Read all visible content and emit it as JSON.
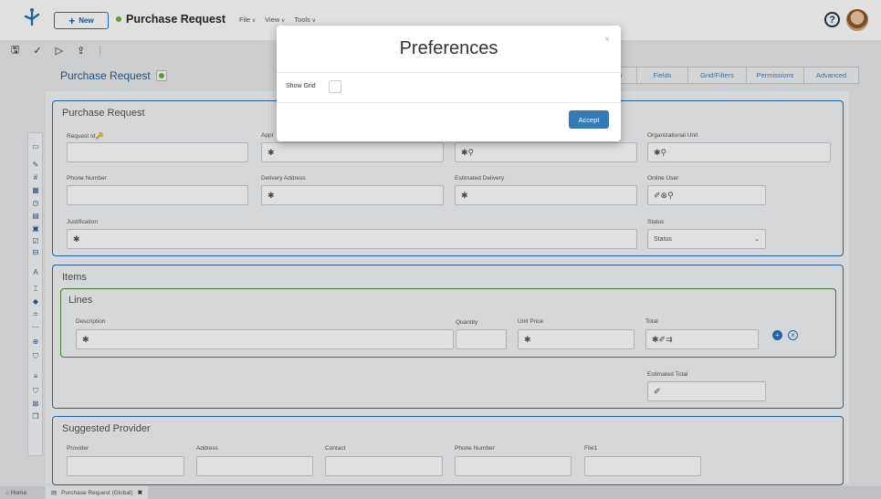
{
  "header": {
    "new_label": "New",
    "app_title": "Purchase Request",
    "menus": [
      "File",
      "View",
      "Tools"
    ]
  },
  "page": {
    "title": "Purchase Request"
  },
  "tabs": [
    "w",
    "Fields",
    "Grid/Filters",
    "Permissions",
    "Advanced"
  ],
  "purchase_request": {
    "title": "Purchase Request",
    "request_id_label": "Request Id",
    "appl_label": "Appl",
    "org_unit_label": "Organizational Unit",
    "org_unit_value": "✱⚲",
    "third_value": "✱⚲",
    "phone_label": "Phone Number",
    "delivery_label": "Delivery Address",
    "delivery_value": "✱",
    "est_delivery_label": "Estimated Delivery",
    "est_delivery_value": "✱",
    "online_user_label": "Online User",
    "online_user_value": "✐⊗⚲",
    "justification_label": "Justification",
    "justification_value": "✱",
    "status_label": "Status",
    "status_value": "Status",
    "appl_value": "✱"
  },
  "items": {
    "title": "Items",
    "lines_title": "Lines",
    "description_label": "Description",
    "description_value": "✱",
    "quantity_label": "Quantity",
    "unit_price_label": "Unit Price",
    "unit_price_value": "✱",
    "total_label": "Total",
    "total_value": "✱✐⇉",
    "estimated_total_label": "Estimated Total",
    "estimated_total_value": "✐"
  },
  "provider": {
    "title": "Suggested Provider",
    "provider_label": "Provider",
    "address_label": "Address",
    "contact_label": "Contact",
    "phone_label": "Phone Number",
    "file_label": "File1"
  },
  "modal": {
    "title": "Preferences",
    "close": "×",
    "show_grid_label": "Show Grid",
    "accept_label": "Accept"
  },
  "footer": {
    "home": "Home",
    "tab": "Purchase Request (Global)",
    "tab_close": "✖"
  },
  "colors": {
    "accent": "#337ab7",
    "panel_border": "#2d6bb0",
    "lines_border": "#4c8c3a",
    "status_dot": "#6ab04c"
  }
}
